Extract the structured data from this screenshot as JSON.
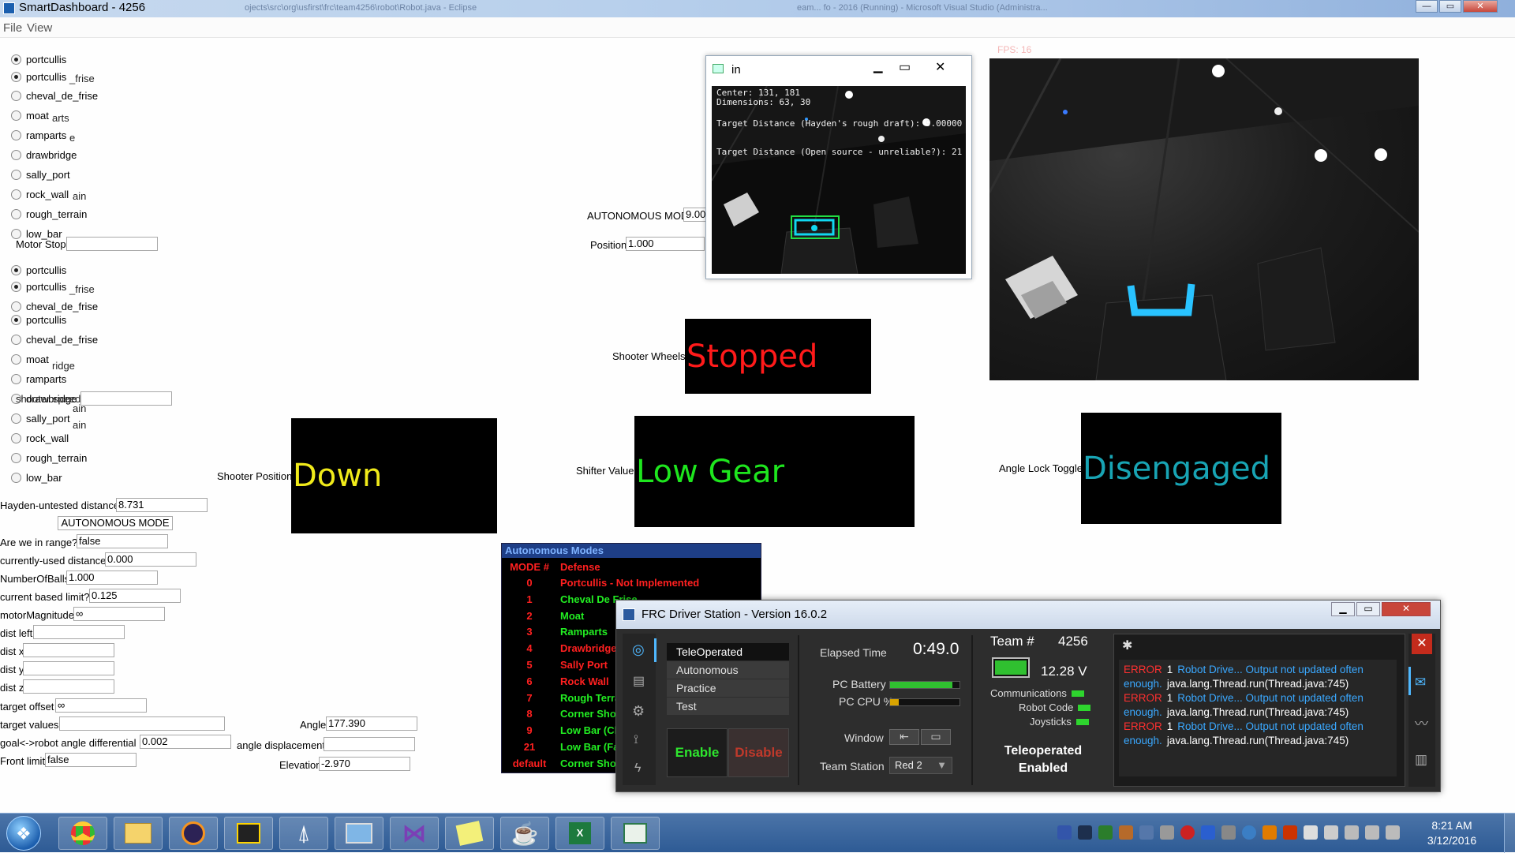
{
  "window": {
    "title": "SmartDashboard - 4256",
    "ghost_left": "ojects\\src\\org\\usfirst\\frc\\team4256\\robot\\Robot.java - Eclipse",
    "ghost_right": "eam... fo - 2016 (Running) - Microsoft Visual Studio (Administra...",
    "minimize": "—",
    "maximize": "▭",
    "close": "✕"
  },
  "menu": {
    "file": "File",
    "view": "View"
  },
  "radio_group_1": [
    {
      "label": "portcullis",
      "checked": true
    },
    {
      "label": "portcullis",
      "checked": true
    },
    {
      "label": "cheval_de_frise",
      "checked": false
    },
    {
      "label": "moat",
      "checked": false
    },
    {
      "label": "ramparts",
      "checked": false
    },
    {
      "label": "drawbridge",
      "checked": false
    },
    {
      "label": "sally_port",
      "checked": false
    },
    {
      "label": "rock_wall",
      "checked": false
    },
    {
      "label": "rough_terrain",
      "checked": false
    },
    {
      "label": "low_bar",
      "checked": false
    }
  ],
  "radio_group_2": [
    {
      "label": "portcullis",
      "checked": true
    },
    {
      "label": "portcullis",
      "checked": true
    },
    {
      "label": "cheval_de_frise",
      "checked": false
    },
    {
      "label": "portcullis",
      "checked": true
    },
    {
      "label": "cheval_de_frise",
      "checked": false
    },
    {
      "label": "moat",
      "checked": false
    },
    {
      "label": "ramparts",
      "checked": false
    },
    {
      "label": "drawbridge",
      "checked": false
    },
    {
      "label": "sally_port",
      "checked": false
    },
    {
      "label": "rock_wall",
      "checked": false
    },
    {
      "label": "rough_terrain",
      "checked": false
    },
    {
      "label": "low_bar",
      "checked": false
    }
  ],
  "ghost_texts": {
    "g1": "_frise",
    "g2": "arts",
    "g3": "e",
    "g4": "ain",
    "g5": "_frise",
    "g6": "ridge",
    "g7": "ain",
    "g8": "ain",
    "g9": "shooter speed"
  },
  "fields": {
    "motor_stop": {
      "label": "Motor Stop",
      "value": ""
    },
    "shooter_speed": {
      "label": "drawbridge",
      "value": ""
    },
    "hayden_distance": {
      "label": "Hayden-untested distance",
      "value": "8.731"
    },
    "autonomous_mode_btn": "AUTONOMOUS MODE",
    "in_range": {
      "label": "Are we in range?",
      "value": "false"
    },
    "current_distance": {
      "label": "currently-used distance",
      "value": "0.000"
    },
    "number_of_balls": {
      "label": "NumberOfBalls",
      "value": "1.000"
    },
    "current_limit": {
      "label": "current based limit?",
      "value": "0.125"
    },
    "motor_magnitude": {
      "label": "motorMagnitude",
      "value": "∞"
    },
    "dist_left": {
      "label": "dist left",
      "value": ""
    },
    "dist_x": {
      "label": "dist x",
      "value": ""
    },
    "dist_y": {
      "label": "dist y",
      "value": ""
    },
    "dist_z": {
      "label": "dist z",
      "value": ""
    },
    "target_offset": {
      "label": "target offset",
      "value": "∞"
    },
    "target_values": {
      "label": "target values",
      "value": ""
    },
    "goal_angle_diff": {
      "label": "goal<->robot angle differential",
      "value": "0.002"
    },
    "front_limit": {
      "label": "Front limit",
      "value": "false"
    },
    "angle": {
      "label": "Angle",
      "value": "177.390"
    },
    "angle_displacement": {
      "label": "angle displacement",
      "value": ""
    },
    "elevation": {
      "label": "Elevation",
      "value": "-2.970"
    },
    "autonomous_mode": {
      "label": "AUTONOMOUS MODE",
      "value": "9.00"
    },
    "position": {
      "label": "Position",
      "value": "1.000"
    }
  },
  "tiles": {
    "shooter_wheels": {
      "label": "Shooter Wheels",
      "value": "Stopped",
      "color": "#ff1a1a"
    },
    "shooter_position": {
      "label": "Shooter Position",
      "value": "Down",
      "color": "#f0ea1a"
    },
    "shifter_value": {
      "label": "Shifter Value",
      "value": "Low Gear",
      "color": "#1ee61e"
    },
    "angle_lock": {
      "label": "Angle Lock Toggle",
      "value": "Disengaged",
      "color": "#18a4b4"
    }
  },
  "cv_window": {
    "title": "in",
    "line1": "Center: 131, 181",
    "line2": "Dimensions: 63, 30",
    "line3": "Target Distance (Hayden's rough draft): 9.00000",
    "line4": "Target Distance (Open source - unreliable?): 21"
  },
  "camera": {
    "fps": "FPS: 16"
  },
  "autonomous": {
    "header": "Autonomous Modes",
    "col_mode": "MODE #",
    "col_defense": "Defense",
    "rows": [
      {
        "num": "0",
        "name": "Portcullis - Not Implemented",
        "color": "#ff2020"
      },
      {
        "num": "1",
        "name": "Cheval De Frise",
        "color": "#22ee22"
      },
      {
        "num": "2",
        "name": "Moat",
        "color": "#22ee22"
      },
      {
        "num": "3",
        "name": "Ramparts",
        "color": "#22ee22"
      },
      {
        "num": "4",
        "name": "Drawbridge",
        "color": "#ff2020"
      },
      {
        "num": "5",
        "name": "Sally Port",
        "color": "#ff2020"
      },
      {
        "num": "6",
        "name": "Rock Wall",
        "color": "#ff2020"
      },
      {
        "num": "7",
        "name": "Rough Terrain",
        "color": "#22ee22"
      },
      {
        "num": "8",
        "name": "Corner Shot",
        "color": "#22ee22"
      },
      {
        "num": "9",
        "name": "Low Bar (Cl",
        "color": "#22ee22"
      },
      {
        "num": "21",
        "name": "Low Bar (Fa",
        "color": "#22ee22"
      },
      {
        "num": "default",
        "name": "Corner Shot",
        "color": "#22ee22"
      }
    ]
  },
  "driver_station": {
    "title": "FRC Driver Station - Version 16.0.2",
    "modes": [
      "TeleOperated",
      "Autonomous",
      "Practice",
      "Test"
    ],
    "enable": "Enable",
    "disable": "Disable",
    "elapsed_label": "Elapsed Time",
    "elapsed": "0:49.0",
    "pc_battery": "PC Battery",
    "pc_battery_level": 0.9,
    "pc_cpu": "PC CPU %",
    "pc_cpu_level": 0.12,
    "window_label": "Window",
    "team_station_label": "Team Station",
    "team_station": "Red 2",
    "team_label": "Team #",
    "team": "4256",
    "voltage": "12.28 V",
    "communications": "Communications",
    "robot_code": "Robot Code",
    "joysticks": "Joysticks",
    "status_line1": "Teleoperated",
    "status_line2": "Enabled",
    "log": [
      {
        "lvl": "ERROR",
        "n": "1",
        "msg": "Robot Drive... Output not updated often",
        "cont": "enough.",
        "src": "java.lang.Thread.run(Thread.java:745)"
      },
      {
        "lvl": "ERROR",
        "n": "1",
        "msg": "Robot Drive... Output not updated often",
        "cont": "enough.",
        "src": "java.lang.Thread.run(Thread.java:745)"
      },
      {
        "lvl": "ERROR",
        "n": "1",
        "msg": "Robot Drive... Output not updated often",
        "cont": "enough.",
        "src": "java.lang.Thread.run(Thread.java:745)"
      }
    ]
  },
  "taskbar": {
    "time": "8:21 AM",
    "date": "3/12/2016",
    "apps": [
      "start-button",
      "chrome",
      "explorer",
      "eclipse",
      "driverstation",
      "labview",
      "remote-desktop",
      "visual-studio",
      "sticky-notes",
      "java",
      "excel",
      "smartdashboard"
    ]
  },
  "colors": {
    "error": "#ff3030",
    "link": "#3aa8ff",
    "battery_green": "#30c030",
    "cpu_yellow": "#d9a400"
  }
}
